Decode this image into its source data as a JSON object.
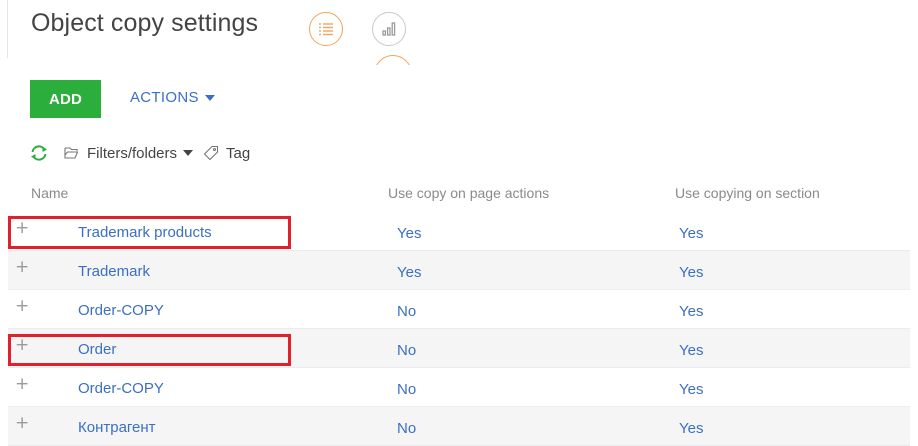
{
  "header": {
    "title": "Object copy settings",
    "view_buttons": [
      {
        "icon": "list-icon",
        "active": true
      },
      {
        "icon": "analytics-icon",
        "active": false
      }
    ]
  },
  "toolbar": {
    "add_label": "ADD",
    "actions_label": "ACTIONS"
  },
  "filters": {
    "filters_label": "Filters/folders",
    "tag_label": "Tag"
  },
  "grid": {
    "columns": [
      "Name",
      "Use copy on page actions",
      "Use copying on section"
    ],
    "rows": [
      {
        "name": "Trademark products",
        "page_actions": "Yes",
        "section": "Yes"
      },
      {
        "name": "Trademark",
        "page_actions": "Yes",
        "section": "Yes"
      },
      {
        "name": "Order-COPY",
        "page_actions": "No",
        "section": "Yes"
      },
      {
        "name": "Order",
        "page_actions": "No",
        "section": "Yes"
      },
      {
        "name": "Order-COPY",
        "page_actions": "No",
        "section": "Yes"
      },
      {
        "name": "Контрагент",
        "page_actions": "No",
        "section": "Yes"
      }
    ],
    "expand_symbol": "+"
  },
  "colors": {
    "accent_green": "#2cae3d",
    "link_blue": "#3b6fc4",
    "highlight_red": "#e0202a",
    "active_view_orange": "#f3a45a"
  }
}
